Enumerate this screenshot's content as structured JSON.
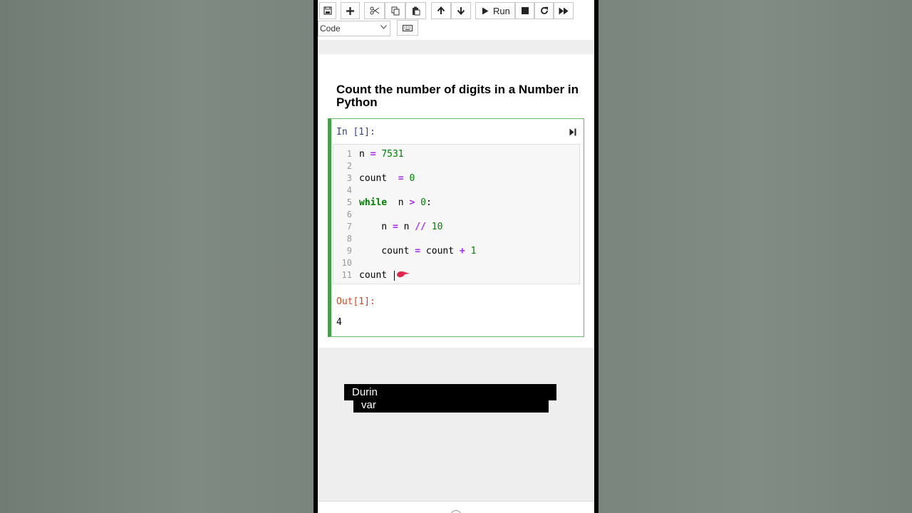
{
  "toolbar": {
    "run_label": "Run",
    "cell_type": "Code"
  },
  "notebook": {
    "heading": "Count the number of digits in a Number in Python",
    "in_prompt": "In [1]:",
    "out_prompt": "Out[1]:",
    "output": "4",
    "line_numbers": [
      "1",
      "2",
      "3",
      "4",
      "5",
      "6",
      "7",
      "8",
      "9",
      "10",
      "11"
    ]
  },
  "caption": {
    "line1": "Durin",
    "line2": "var"
  },
  "colors": {
    "cell_border": "#43a047",
    "keyword": "#008000",
    "operator": "#aa22ff",
    "in_prompt": "#303f9f",
    "out_prompt": "#d84315"
  }
}
